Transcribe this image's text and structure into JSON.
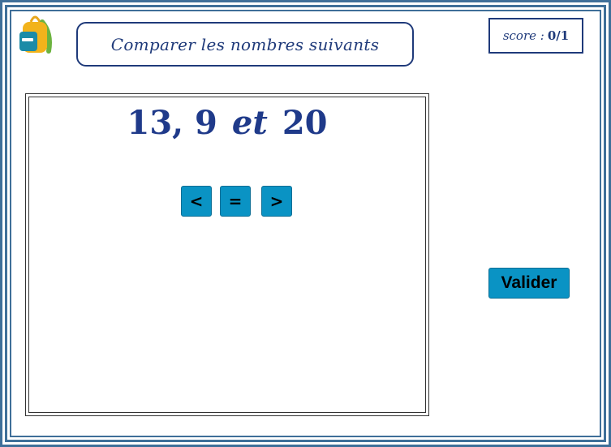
{
  "header": {
    "instruction": "Comparer les nombres suivants",
    "score_label": "score :",
    "score_value": "0/1",
    "logo_icon": "backpack-icon"
  },
  "question": {
    "left_number": "13, 9",
    "conjunction": "et",
    "right_number": "20"
  },
  "choices": [
    "<",
    "=",
    ">"
  ],
  "actions": {
    "validate_label": "Valider"
  },
  "colors": {
    "accent": "#0a93c4",
    "text": "#1f3a8a",
    "frame": "#3f6f99"
  }
}
